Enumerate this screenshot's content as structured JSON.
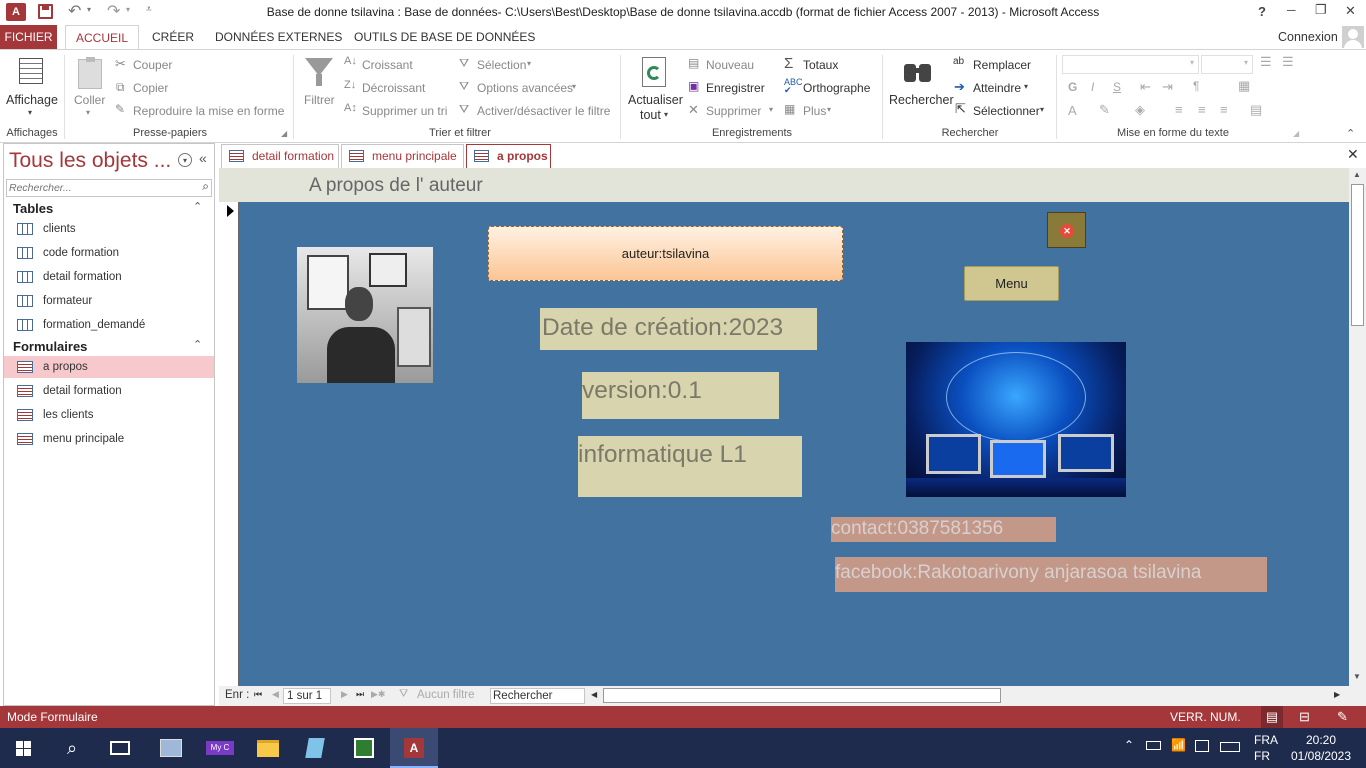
{
  "window": {
    "title": "Base de donne tsilavina : Base de données- C:\\Users\\Best\\Desktop\\Base de donne tsilavina.accdb (format de fichier Access 2007 - 2013) - Microsoft Access",
    "help": "?",
    "min": "─",
    "restore": "❐",
    "close": "✕"
  },
  "ribbon_tabs": {
    "fichier": "FICHIER",
    "accueil": "ACCUEIL",
    "creer": "CRÉER",
    "donnees": "DONNÉES EXTERNES",
    "outils": "OUTILS DE BASE DE DONNÉES",
    "connexion": "Connexion"
  },
  "ribbon": {
    "affichage": "Affichage",
    "coller": "Coller",
    "couper": "Couper",
    "copier": "Copier",
    "reproduire": "Reproduire la mise en forme",
    "filtrer": "Filtrer",
    "croissant": "Croissant",
    "decroissant": "Décroissant",
    "supprimer_tri": "Supprimer un tri",
    "selection": "Sélection",
    "options_avancees": "Options avancées",
    "activer_filtre": "Activer/désactiver le filtre",
    "actualiser": "Actualiser",
    "tout": "tout",
    "nouveau": "Nouveau",
    "enregistrer": "Enregistrer",
    "supprimer": "Supprimer",
    "totaux": "Totaux",
    "orthographe": "Orthographe",
    "plus": "Plus",
    "rechercher": "Rechercher",
    "remplacer": "Remplacer",
    "atteindre": "Atteindre",
    "selectionner": "Sélectionner",
    "groups": {
      "affichages": "Affichages",
      "presse_papiers": "Presse-papiers",
      "trier_filtrer": "Trier et filtrer",
      "enregistrements": "Enregistrements",
      "rechercher": "Rechercher",
      "mise_en_forme": "Mise en forme du texte"
    },
    "fmt": {
      "g": "G",
      "i": "I",
      "s": "S",
      "a": "A"
    }
  },
  "nav": {
    "title": "Tous les objets ...",
    "search_placeholder": "Rechercher...",
    "tables_header": "Tables",
    "tables": [
      "clients",
      "code formation",
      "detail formation",
      "formateur",
      "formation_demandé"
    ],
    "forms_header": "Formulaires",
    "forms": [
      "a propos",
      "detail formation",
      "les clients",
      "menu principale"
    ]
  },
  "doc_tabs": [
    "detail formation",
    "menu principale",
    "a propos"
  ],
  "form": {
    "header_title": "A propos de l' auteur",
    "auteur": "auteur:tsilavina",
    "date": "Date de création:2023",
    "version": "version:0.1",
    "informatique": "informatique L1",
    "menu": "Menu",
    "contact": "contact:0387581356",
    "facebook": "facebook:Rakotoarivony anjarasoa tsilavina"
  },
  "recnav": {
    "enr": "Enr :",
    "position": "1 sur 1",
    "filter": "Aucun filtre",
    "search": "Rechercher"
  },
  "status": {
    "mode": "Mode Formulaire",
    "indicators": "VERR. NUM."
  },
  "taskbar": {
    "lang1": "FRA",
    "lang2": "FR",
    "time": "20:20",
    "date": "01/08/2023",
    "myc": "My C"
  },
  "colors": {
    "access_red": "#a4373a",
    "form_blue": "#4272a0",
    "khaki": "#d8d4ad",
    "salmon": "#c39888",
    "taskbar": "#1e2b4d"
  }
}
